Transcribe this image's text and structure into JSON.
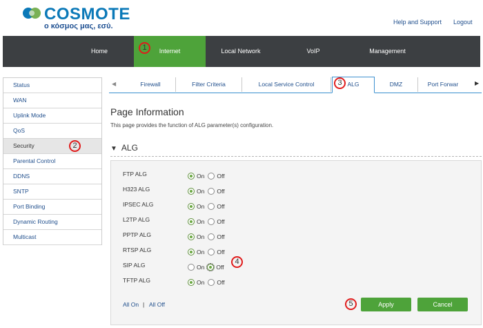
{
  "brand": {
    "name": "COSMOTE",
    "tagline": "ο κόσμος μας, εσύ."
  },
  "header_links": {
    "help": "Help and Support",
    "logout": "Logout"
  },
  "nav": [
    "Home",
    "Internet",
    "Local Network",
    "VoIP",
    "Management"
  ],
  "nav_active": "Internet",
  "sidebar": [
    "Status",
    "WAN",
    "Uplink Mode",
    "QoS",
    "Security",
    "Parental Control",
    "DDNS",
    "SNTP",
    "Port Binding",
    "Dynamic Routing",
    "Multicast"
  ],
  "sidebar_active": "Security",
  "tabs": [
    "Firewall",
    "Filter Criteria",
    "Local Service Control",
    "ALG",
    "DMZ",
    "Port Forwar"
  ],
  "tab_active": "ALG",
  "page": {
    "title": "Page Information",
    "description": "This page provides the function of ALG parameter(s) configuration."
  },
  "section": {
    "title": "ALG"
  },
  "radio_labels": {
    "on": "On",
    "off": "Off"
  },
  "algs": [
    {
      "name": "FTP ALG",
      "state": "on"
    },
    {
      "name": "H323 ALG",
      "state": "on"
    },
    {
      "name": "IPSEC ALG",
      "state": "on"
    },
    {
      "name": "L2TP ALG",
      "state": "on"
    },
    {
      "name": "PPTP ALG",
      "state": "on"
    },
    {
      "name": "RTSP ALG",
      "state": "on"
    },
    {
      "name": "SIP ALG",
      "state": "off"
    },
    {
      "name": "TFTP ALG",
      "state": "on"
    }
  ],
  "footer": {
    "all_on": "All On",
    "separator": "|",
    "all_off": "All Off",
    "apply": "Apply",
    "cancel": "Cancel"
  },
  "markers": [
    "1",
    "2",
    "3",
    "4",
    "5"
  ],
  "colors": {
    "brand_blue": "#0b79b8",
    "nav_bg": "#3c3f42",
    "accent_green": "#4ea33a",
    "marker_red": "#e01b1b",
    "link_blue": "#1f4e8c"
  }
}
